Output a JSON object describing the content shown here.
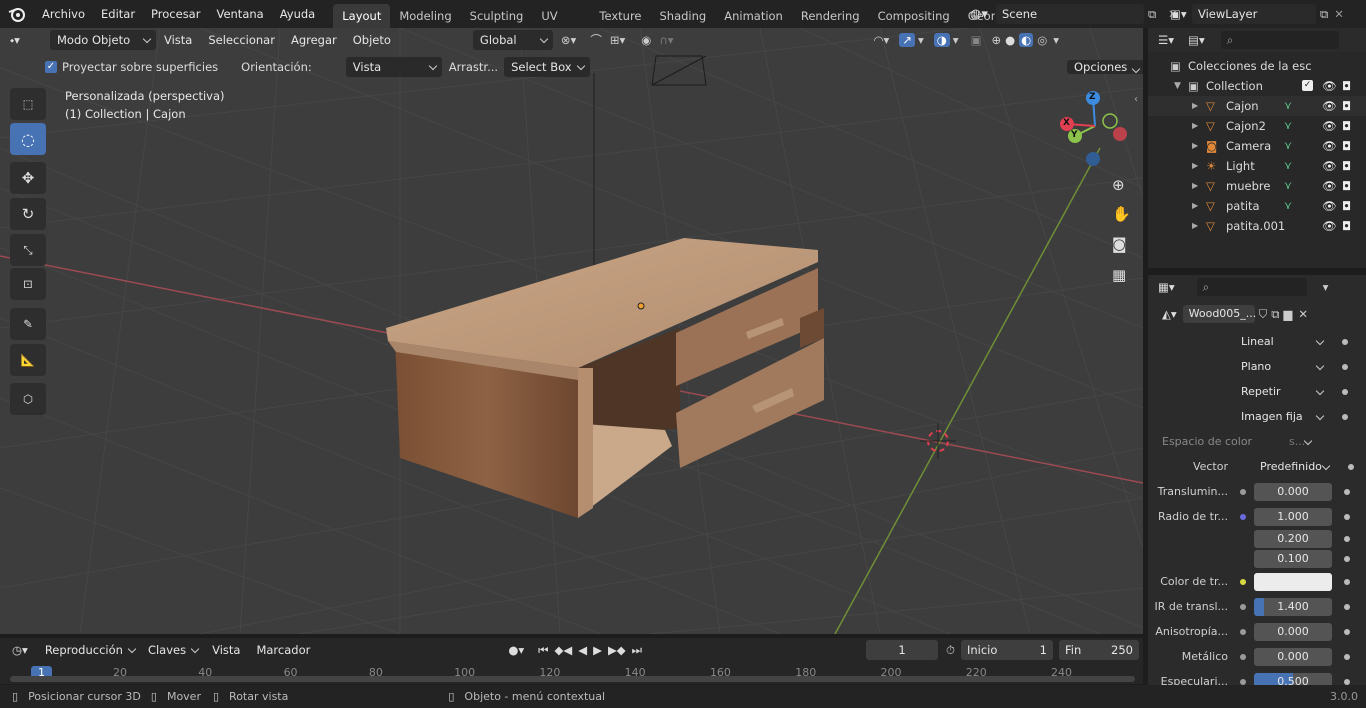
{
  "menus": [
    "Archivo",
    "Editar",
    "Procesar",
    "Ventana",
    "Ayuda"
  ],
  "workspaces": [
    "Layout",
    "Modeling",
    "Sculpting",
    "UV Editing",
    "Texture Paint",
    "Shading",
    "Animation",
    "Rendering",
    "Compositing",
    "Geom"
  ],
  "scene": "Scene",
  "view_layer": "ViewLayer",
  "viewport": {
    "mode": "Modo Objeto",
    "menus": [
      "Vista",
      "Seleccionar",
      "Agregar",
      "Objeto"
    ],
    "transform_orientation": "Global",
    "project_surface_label": "Proyectar sobre superficies",
    "orientation_label": "Orientación:",
    "orientation_value": "Vista",
    "drag_label": "Arrastr...",
    "drag_value": "Select Box",
    "options_label": "Opciones",
    "info_line1": "Personalizada (perspectiva)",
    "info_line2": "(1) Collection | Cajon",
    "gizmo_axes": {
      "x": "X",
      "y": "Y",
      "z": "Z"
    }
  },
  "outliner": {
    "root": "Colecciones de la esc",
    "collection": "Collection",
    "items": [
      {
        "name": "Cajon",
        "icon": "mesh-icon"
      },
      {
        "name": "Cajon2",
        "icon": "mesh-icon"
      },
      {
        "name": "Camera",
        "icon": "camera-icon"
      },
      {
        "name": "Light",
        "icon": "light-icon"
      },
      {
        "name": "muebre",
        "icon": "mesh-icon"
      },
      {
        "name": "patita",
        "icon": "mesh-icon"
      },
      {
        "name": "patita.001",
        "icon": "mesh-icon"
      }
    ]
  },
  "properties": {
    "texture_name": "Wood005_...",
    "dropdowns": [
      "Lineal",
      "Plano",
      "Repetir",
      "Imagen fija"
    ],
    "color_space_label": "Espacio de color",
    "color_space_value": "s...",
    "vector_label": "Vector",
    "vector_value": "Predefinido",
    "rows": [
      {
        "label": "Translumin...",
        "value": "0.000",
        "dot": "#9a9a9a"
      },
      {
        "label": "Radio de tr...",
        "value": "1.000",
        "dot": "#6a6adc"
      },
      {
        "label": "",
        "value": "0.200",
        "dot": ""
      },
      {
        "label": "",
        "value": "0.100",
        "dot": ""
      }
    ],
    "color_label": "Color de tr...",
    "rows2": [
      {
        "label": "IR de transl...",
        "value": "1.400",
        "fill": 0.13
      },
      {
        "label": "Anisotropía...",
        "value": "0.000",
        "fill": 0
      },
      {
        "label": "Metálico",
        "value": "0.000",
        "fill": 0
      },
      {
        "label": "Especulari...",
        "value": "0.500",
        "fill": 0.5
      }
    ]
  },
  "timeline": {
    "menus": [
      "Reproducción",
      "Claves",
      "Vista",
      "Marcador"
    ],
    "current_frame": "1",
    "start_label": "Inicio",
    "start": "1",
    "end_label": "Fin",
    "end": "250",
    "ticks": [
      "1",
      "20",
      "40",
      "60",
      "80",
      "100",
      "120",
      "140",
      "160",
      "180",
      "200",
      "220",
      "240"
    ]
  },
  "status": {
    "left": "Posicionar cursor 3D",
    "mid": "Mover",
    "right": "Rotar vista",
    "context": "Objeto - menú contextual",
    "version": "3.0.0"
  },
  "colors": {
    "accent": "#4772b3",
    "x": "#e04050",
    "y": "#8bc34a",
    "z": "#3d8be0"
  }
}
